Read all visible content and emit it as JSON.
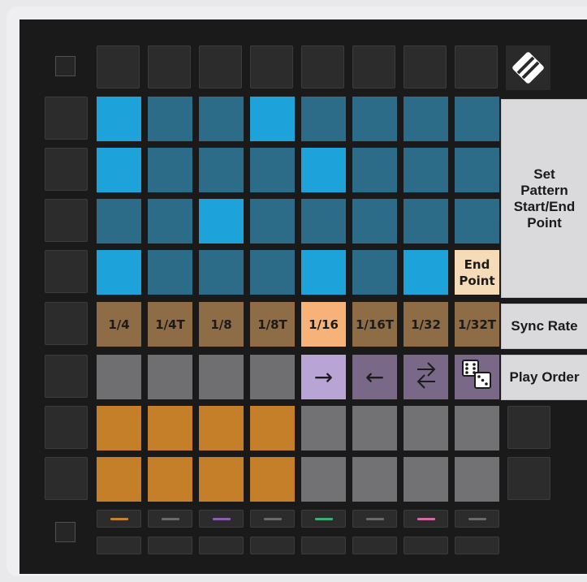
{
  "colors": {
    "bright_blue": "#1ea2da",
    "dim_blue": "#2d6c88",
    "sync_rate": "#8e6c46",
    "sync_rate_selected": "#f7b27a",
    "end_point": "#f5dbb7",
    "play_order_idle": "#6f6f72",
    "play_order_selected": "#b9a4d6",
    "play_order_dim": "#7a6889",
    "orange": "#c57f29",
    "gray": "#727275"
  },
  "labels": {
    "set_pattern": "Set Pattern Start/End Point",
    "sync_rate": "Sync Rate",
    "play_order": "Play Order"
  },
  "end_point_label": "End Point",
  "sync_rates": [
    "1/4",
    "1/4T",
    "1/8",
    "1/8T",
    "1/16",
    "1/16T",
    "1/32",
    "1/32T"
  ],
  "pattern_grid": [
    [
      "bright",
      "dim",
      "dim",
      "bright",
      "dim",
      "dim",
      "dim",
      "dim"
    ],
    [
      "bright",
      "dim",
      "dim",
      "dim",
      "bright",
      "dim",
      "dim",
      "dim"
    ],
    [
      "dim",
      "dim",
      "bright",
      "dim",
      "dim",
      "dim",
      "dim",
      "dim"
    ],
    [
      "bright",
      "dim",
      "dim",
      "dim",
      "bright",
      "dim",
      "bright",
      "end"
    ]
  ],
  "play_order": [
    {
      "icon": "",
      "state": "idle"
    },
    {
      "icon": "",
      "state": "idle"
    },
    {
      "icon": "",
      "state": "idle"
    },
    {
      "icon": "",
      "state": "idle"
    },
    {
      "icon": "forward-arrow-icon",
      "glyph": "→",
      "state": "selected"
    },
    {
      "icon": "backward-arrow-icon",
      "glyph": "←",
      "state": "dim"
    },
    {
      "icon": "ping-pong-arrows-icon",
      "glyph": "⇄",
      "state": "dim"
    },
    {
      "icon": "dice-icon",
      "glyph": "",
      "state": "dim"
    }
  ],
  "bottom_rows": [
    [
      "orange",
      "orange",
      "orange",
      "orange",
      "gray",
      "gray",
      "gray",
      "gray"
    ],
    [
      "orange",
      "orange",
      "orange",
      "orange",
      "gray",
      "gray",
      "gray",
      "gray"
    ]
  ],
  "track_leds": [
    "#c9812c",
    "#6a6a6c",
    "#8a5fb2",
    "#6a6a6c",
    "#3fae74",
    "#6a6a6c",
    "#d46aa6",
    "#6a6a6c"
  ]
}
